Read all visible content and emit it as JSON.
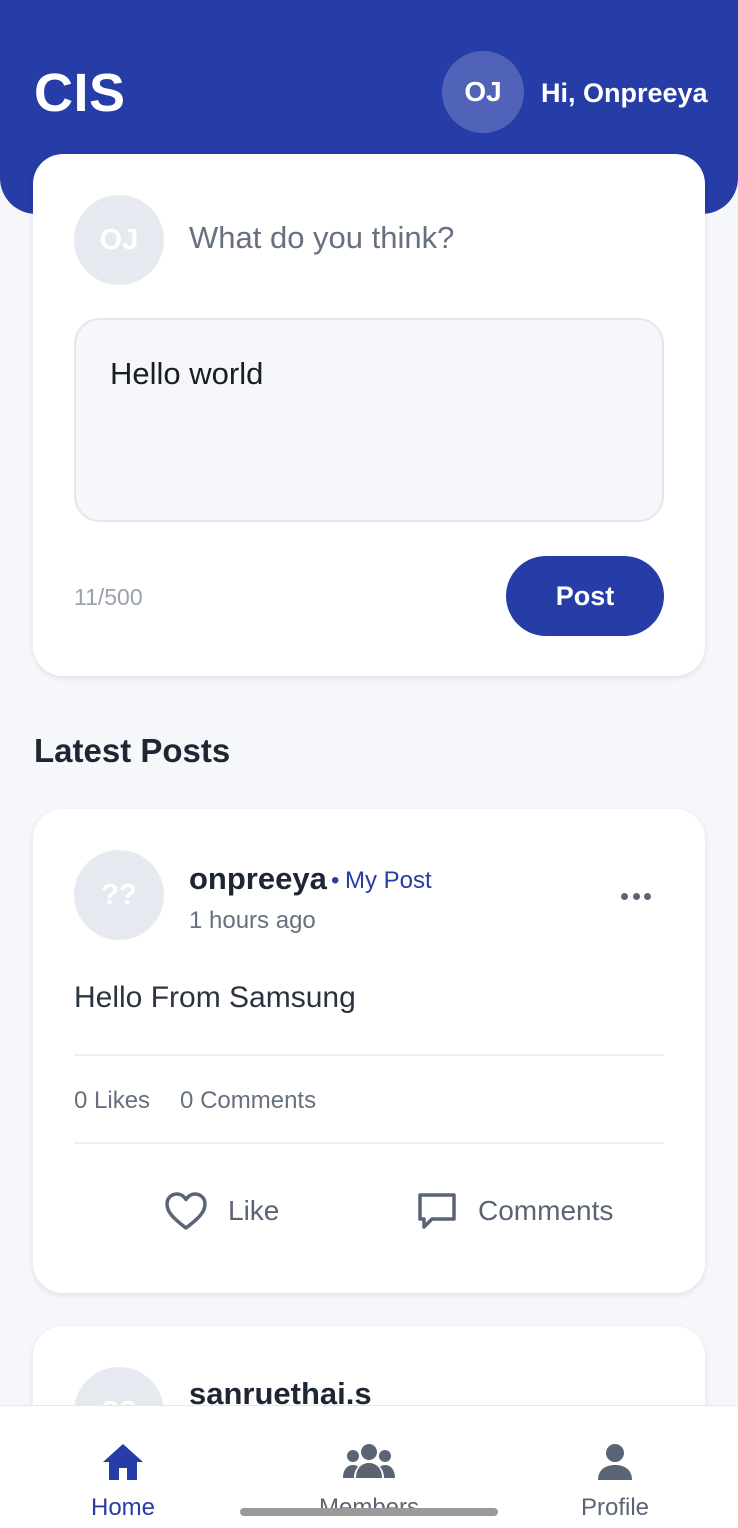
{
  "header": {
    "brand": "CIS",
    "avatar_initials": "OJ",
    "greeting": "Hi, Onpreeya"
  },
  "composer": {
    "avatar_initials": "OJ",
    "prompt": "What do you think?",
    "text_value": "Hello world",
    "char_count": "11/500",
    "post_label": "Post"
  },
  "feed": {
    "title": "Latest Posts",
    "posts": [
      {
        "avatar_initials": "??",
        "author": "onpreeya",
        "separator": "•",
        "tag": "My Post",
        "time": "1 hours ago",
        "text": "Hello From Samsung",
        "likes": "0 Likes",
        "comments": "0 Comments",
        "like_label": "Like",
        "comments_label": "Comments"
      },
      {
        "avatar_initials": "??",
        "author": "sanruethai.s"
      }
    ]
  },
  "nav": {
    "items": [
      {
        "label": "Home",
        "icon": "home-icon",
        "active": true
      },
      {
        "label": "Members",
        "icon": "members-icon",
        "active": false
      },
      {
        "label": "Profile",
        "icon": "profile-icon",
        "active": false
      }
    ]
  },
  "colors": {
    "primary": "#263ca6",
    "background": "#f6f7fa",
    "muted_text": "#66707f"
  }
}
